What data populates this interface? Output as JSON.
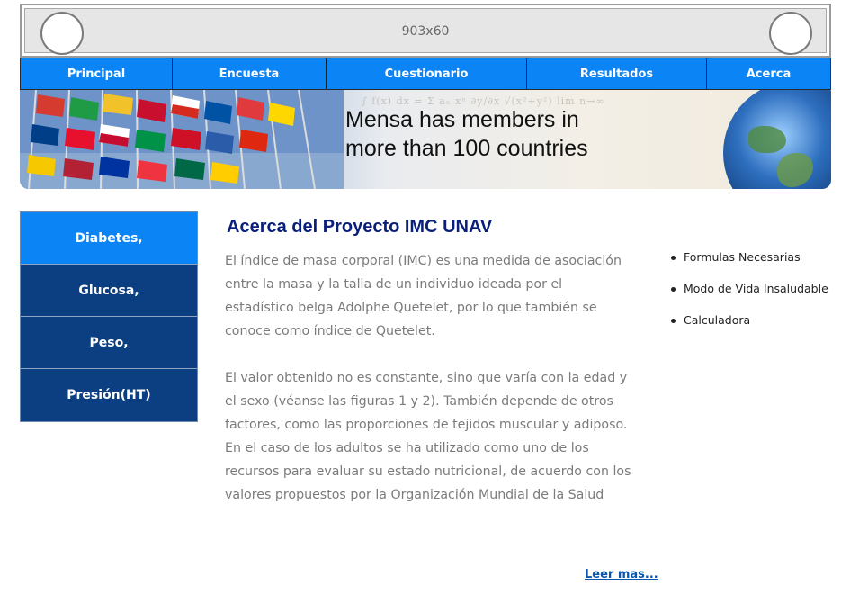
{
  "header": {
    "placeholder_text": "903x60"
  },
  "nav": {
    "items": [
      {
        "label": "Principal"
      },
      {
        "label": "Encuesta"
      },
      {
        "label": "Cuestionario"
      },
      {
        "label": "Resultados"
      },
      {
        "label": "Acerca"
      }
    ]
  },
  "banner": {
    "line1": "Mensa has members in",
    "line2": "more than 100 countries"
  },
  "sidebar": {
    "items": [
      {
        "label": "Diabetes,"
      },
      {
        "label": "Glucosa,"
      },
      {
        "label": "Peso,"
      },
      {
        "label": "Presión(HT)"
      }
    ]
  },
  "main": {
    "title": "Acerca del Proyecto IMC UNAV",
    "paragraph1": "El índice de masa corporal (IMC) es una medida de asociación entre la masa y la talla de un individuo ideada por el estadístico belga Adolphe Quetelet, por lo que también se conoce como índice de Quetelet.",
    "paragraph2": "El valor obtenido no es constante, sino que varía con la edad y el sexo (véanse las figuras 1 y 2). También depende de otros factores, como las proporciones de tejidos muscular y adiposo. En el caso de los adultos se ha utilizado como uno de los recursos para evaluar su estado nutricional, de acuerdo con los valores propuestos por la Organización Mundial de la Salud",
    "read_more": "Leer mas..."
  },
  "right_links": [
    {
      "label": "Formulas Necesarias"
    },
    {
      "label": "Modo de Vida Insaludable"
    },
    {
      "label": "Calculadora"
    }
  ],
  "colors": {
    "nav_bg": "#0b84f6",
    "sidebar_bg": "#0c3f82",
    "sidebar_active": "#0b84f6",
    "title": "#0a1f7a"
  }
}
